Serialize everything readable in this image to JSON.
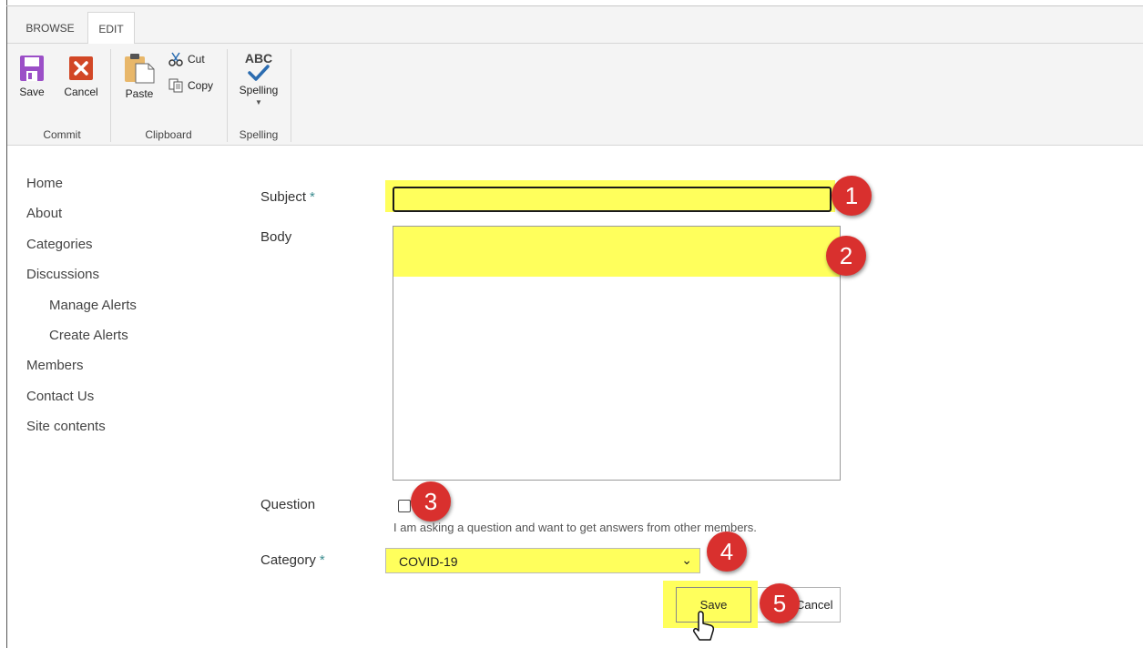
{
  "ribbon": {
    "tabs": [
      "BROWSE",
      "EDIT"
    ],
    "commit": {
      "save": "Save",
      "cancel": "Cancel",
      "group": "Commit"
    },
    "clipboard": {
      "paste": "Paste",
      "cut": "Cut",
      "copy": "Copy",
      "group": "Clipboard"
    },
    "spelling": {
      "abc": "ABC",
      "label": "Spelling",
      "group": "Spelling"
    }
  },
  "nav": {
    "items": [
      "Home",
      "About",
      "Categories",
      "Discussions",
      "Manage Alerts",
      "Create Alerts",
      "Members",
      "Contact Us",
      "Site contents"
    ]
  },
  "form": {
    "subject_label": "Subject",
    "required_mark": "*",
    "subject_value": "",
    "body_label": "Body",
    "question_label": "Question",
    "question_hint": "I am asking a question and want to get answers from other members.",
    "category_label": "Category",
    "category_value": "COVID-19",
    "save": "Save",
    "cancel": "Cancel"
  },
  "markers": [
    "1",
    "2",
    "3",
    "4",
    "5"
  ],
  "colors": {
    "highlight": "#ffff5c",
    "marker": "#d9302e",
    "required": "#3b8c8f",
    "save_icon": "#9b4fc7",
    "cancel_icon": "#d24726",
    "check": "#2b6cb0"
  },
  "icons": [
    "save-icon",
    "cancel-icon",
    "paste-icon",
    "cut-icon",
    "copy-icon",
    "spelling-check-icon",
    "chevron-down-icon",
    "pointer-cursor-icon"
  ]
}
